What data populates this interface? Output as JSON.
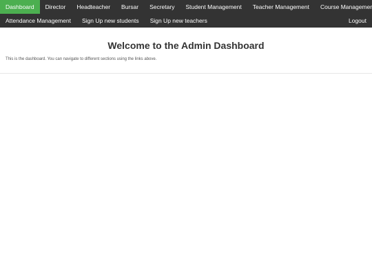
{
  "nav": {
    "row1": [
      {
        "label": "Dashboard",
        "active": true
      },
      {
        "label": "Director"
      },
      {
        "label": "Headteacher"
      },
      {
        "label": "Bursar"
      },
      {
        "label": "Secretary"
      },
      {
        "label": "Student Management"
      },
      {
        "label": "Teacher Management"
      },
      {
        "label": "Course Management"
      }
    ],
    "row2": [
      {
        "label": "Attendance Management"
      },
      {
        "label": "Sign Up new students"
      },
      {
        "label": "Sign Up new teachers"
      }
    ],
    "logout_label": "Logout",
    "active_color": "#4caf50",
    "bar_color": "#333333"
  },
  "main": {
    "title": "Welcome to the Admin Dashboard",
    "description": "This is the dashboard. You can navigate to different sections using the links above."
  }
}
